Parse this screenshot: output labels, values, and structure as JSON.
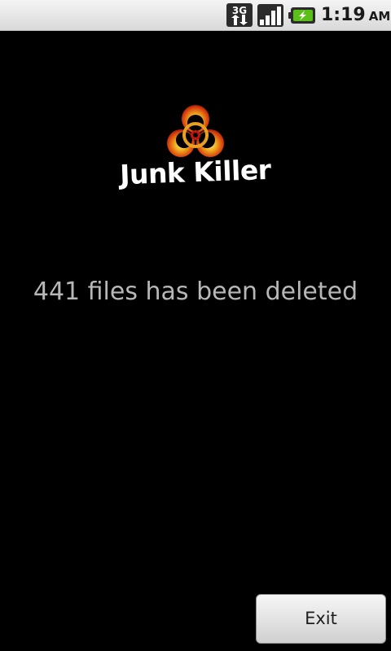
{
  "status_bar": {
    "network_label": "3G",
    "time": "1:19",
    "ampm": "AM",
    "icons": [
      "3g-data-icon",
      "signal-strength-icon",
      "battery-charging-icon"
    ]
  },
  "logo": {
    "icon": "biohazard-icon",
    "text": "Junk Killer",
    "colors": {
      "hazard_outer": "#e8a020",
      "hazard_inner": "#c0160c",
      "text": "#ffffff"
    }
  },
  "main": {
    "message": "441 files has been deleted"
  },
  "actions": {
    "exit_label": "Exit"
  },
  "colors": {
    "background": "#000000",
    "message_text": "#b7b7b7",
    "status_bar_bg": "#e6e6e6",
    "battery_accent": "#5bbf1a"
  }
}
